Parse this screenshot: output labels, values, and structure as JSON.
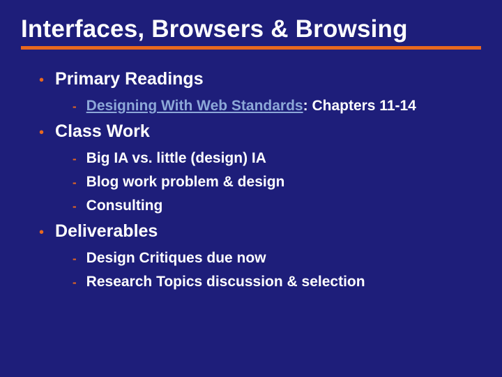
{
  "title": "Interfaces, Browsers & Browsing",
  "sections": [
    {
      "heading": "Primary Readings",
      "items": [
        {
          "link": "Designing With Web Standards",
          "rest": ": Chapters 11-14"
        }
      ]
    },
    {
      "heading": "Class Work",
      "items": [
        {
          "text": "Big IA vs. little (design) IA"
        },
        {
          "text": "Blog work problem & design"
        },
        {
          "text": "Consulting"
        }
      ]
    },
    {
      "heading": "Deliverables",
      "items": [
        {
          "text": "Design Critiques due now"
        },
        {
          "text": "Research Topics discussion & selection"
        }
      ]
    }
  ]
}
